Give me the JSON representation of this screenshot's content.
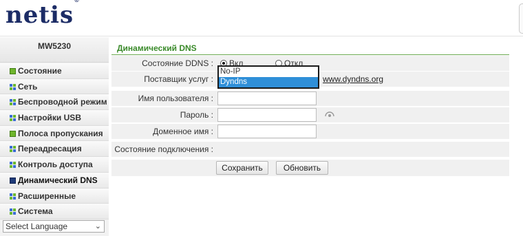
{
  "brand": {
    "logo": "netis",
    "logo_mark": "®"
  },
  "sidebar": {
    "model": "MW5230",
    "items": [
      {
        "label": "Состояние",
        "icon": "green-square-icon"
      },
      {
        "label": "Сеть",
        "icon": "grid-icon"
      },
      {
        "label": "Беспроводной режим",
        "icon": "grid-icon"
      },
      {
        "label": "Настройки USB",
        "icon": "grid-icon"
      },
      {
        "label": "Полоса пропускания",
        "icon": "green-square-icon"
      },
      {
        "label": "Переадресация",
        "icon": "grid-icon"
      },
      {
        "label": "Контроль доступа",
        "icon": "grid-icon"
      },
      {
        "label": "Динамический DNS",
        "icon": "dark-square-icon"
      },
      {
        "label": "Расширенные",
        "icon": "grid-icon"
      },
      {
        "label": "Система",
        "icon": "grid-icon"
      }
    ],
    "language": {
      "selected": "Select Language"
    }
  },
  "main": {
    "title": "Динамический DNS",
    "rows": {
      "ddns_status": {
        "label": "Состояние DDNS :",
        "on": "Вкл",
        "off": "Откл",
        "value": "on"
      },
      "provider": {
        "label": "Поставщик услуг :",
        "link": "www.dyndns.org"
      },
      "username": {
        "label": "Имя пользователя :",
        "value": ""
      },
      "password": {
        "label": "Пароль :",
        "value": ""
      },
      "domain": {
        "label": "Доменное имя :",
        "value": ""
      },
      "conn_status": {
        "label": "Состояние подключения :",
        "value": ""
      }
    },
    "buttons": {
      "save": "Сохранить",
      "refresh": "Обновить"
    },
    "provider_dropdown": {
      "options": [
        "No-IP",
        "Dyndns"
      ],
      "selected": "Dyndns"
    }
  },
  "colors": {
    "accent_green": "#3a8a2a",
    "selection_blue": "#2f8fd8",
    "logo_navy": "#1c2c66"
  }
}
